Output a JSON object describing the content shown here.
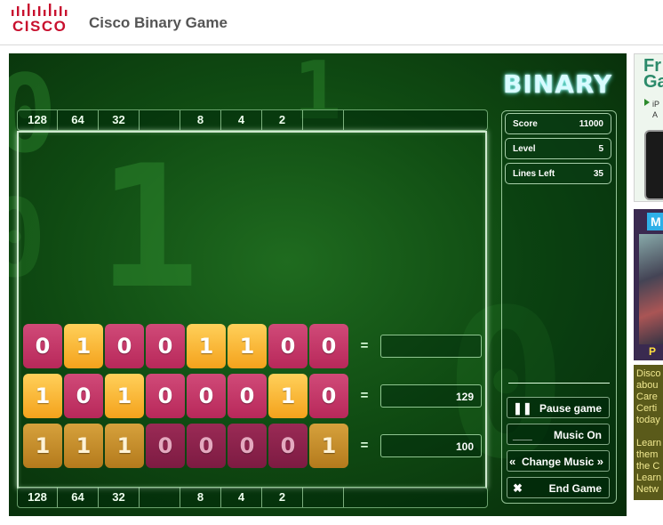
{
  "header": {
    "logo_text": "CISCO",
    "title": "Cisco Binary Game"
  },
  "game": {
    "brand": "BINARY",
    "place_values_top": [
      "128",
      "64",
      "32",
      "",
      "8",
      "4",
      "2",
      "",
      ""
    ],
    "place_values_bottom": [
      "128",
      "64",
      "32",
      "",
      "8",
      "4",
      "2",
      "",
      ""
    ],
    "rows": [
      {
        "bits": [
          "0",
          "1",
          "0",
          "0",
          "1",
          "1",
          "0",
          "0"
        ],
        "style": "bright",
        "answer": ""
      },
      {
        "bits": [
          "1",
          "0",
          "1",
          "0",
          "0",
          "0",
          "1",
          "0"
        ],
        "style": "bright",
        "answer": "129"
      },
      {
        "bits": [
          "1",
          "1",
          "1",
          "0",
          "0",
          "0",
          "0",
          "1"
        ],
        "style": "dim",
        "answer": "100"
      }
    ],
    "equals": "=",
    "stats": {
      "score_label": "Score",
      "score_value": "11000",
      "level_label": "Level",
      "level_value": "5",
      "lines_label": "Lines Left",
      "lines_value": "35"
    },
    "buttons": {
      "pause": "Pause game",
      "music": "Music On",
      "change_music": "Change Music",
      "end": "End Game"
    },
    "icons": {
      "pause": "pause-icon",
      "music": "music-line-icon",
      "change_music": "double-chevron-icon",
      "end": "close-icon"
    },
    "colors": {
      "one_tile": "#f4a21c",
      "zero_tile": "#b8285a",
      "background": "#0f4a12"
    }
  },
  "ads": {
    "ad1_headline": "Fr\nGa",
    "ad1_text": "iP\nA",
    "ad2_tag": "M",
    "ad2_caption": "P",
    "ad3_text": "Disco\nabou\nCare\nCerti\ntoday\n\nLearn\nthem\nthe C\nLearn\nNetw"
  }
}
